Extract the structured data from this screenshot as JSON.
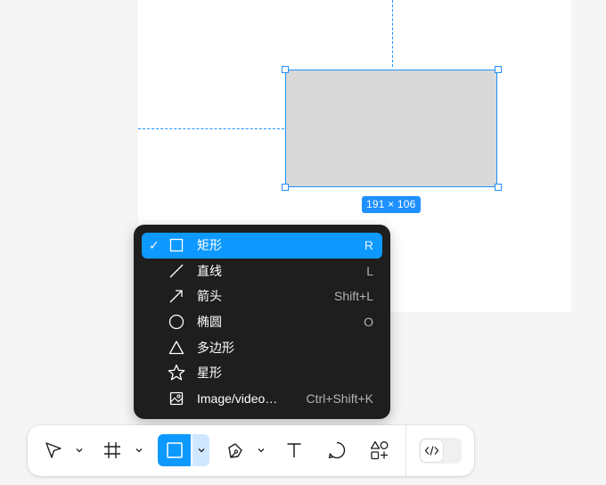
{
  "canvas": {
    "dimension_label": "191 × 106",
    "accent_color": "#1e90ff"
  },
  "shape_menu": {
    "items": [
      {
        "label": "矩形",
        "shortcut": "R",
        "icon": "rectangle-icon",
        "selected": true
      },
      {
        "label": "直线",
        "shortcut": "L",
        "icon": "line-icon",
        "selected": false
      },
      {
        "label": "箭头",
        "shortcut": "Shift+L",
        "icon": "arrow-icon",
        "selected": false
      },
      {
        "label": "椭圆",
        "shortcut": "O",
        "icon": "ellipse-icon",
        "selected": false
      },
      {
        "label": "多边形",
        "shortcut": "",
        "icon": "polygon-icon",
        "selected": false
      },
      {
        "label": "星形",
        "shortcut": "",
        "icon": "star-icon",
        "selected": false
      },
      {
        "label": "Image/video…",
        "shortcut": "Ctrl+Shift+K",
        "icon": "image-icon",
        "selected": false
      }
    ],
    "check_mark": "✓",
    "highlight_color": "#0d99ff"
  },
  "toolbar": {
    "tools": [
      {
        "icon": "move-icon",
        "has_dropdown": true
      },
      {
        "icon": "frame-icon",
        "has_dropdown": true
      },
      {
        "icon": "rectangle-icon",
        "has_dropdown": true,
        "active": true
      },
      {
        "icon": "pen-icon",
        "has_dropdown": true
      },
      {
        "icon": "text-icon",
        "has_dropdown": false
      },
      {
        "icon": "comment-icon",
        "has_dropdown": false
      },
      {
        "icon": "actions-icon",
        "has_dropdown": false
      }
    ],
    "dev_mode_icon": "code-icon"
  }
}
